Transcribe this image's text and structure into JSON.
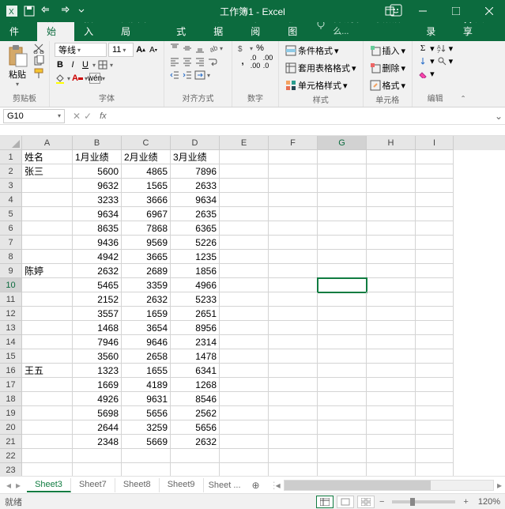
{
  "titlebar": {
    "title": "工作簿1 - Excel"
  },
  "tabs": {
    "file": "文件",
    "home": "开始",
    "insert": "插入",
    "layout": "页面布局",
    "formulas": "公式",
    "data": "数据",
    "review": "审阅",
    "view": "视图",
    "tellme": "告诉我您想要做什么...",
    "login": "登录",
    "share": "共享"
  },
  "ribbon": {
    "clipboard": {
      "label": "剪贴板",
      "paste": "粘贴"
    },
    "font": {
      "label": "字体",
      "name": "等线",
      "size": "11"
    },
    "align": {
      "label": "对齐方式",
      "wrap": ""
    },
    "number": {
      "label": "数字"
    },
    "styles": {
      "label": "样式",
      "cond": "条件格式",
      "table": "套用表格格式",
      "cell": "单元格样式"
    },
    "cells": {
      "label": "单元格",
      "insert": "插入",
      "delete": "删除",
      "format": "格式"
    },
    "editing": {
      "label": "编辑"
    }
  },
  "namebox": "G10",
  "formula": "",
  "columns": [
    "A",
    "B",
    "C",
    "D",
    "E",
    "F",
    "G",
    "H",
    "I"
  ],
  "row_count": 23,
  "selected": {
    "row": 10,
    "col": "G"
  },
  "data_cells": {
    "headers": [
      "姓名",
      "1月业绩",
      "2月业绩",
      "3月业绩"
    ],
    "rows": [
      {
        "a": "张三",
        "b": 5600,
        "c": 4865,
        "d": 7896
      },
      {
        "a": "",
        "b": 9632,
        "c": 1565,
        "d": 2633
      },
      {
        "a": "",
        "b": 3233,
        "c": 3666,
        "d": 9634
      },
      {
        "a": "",
        "b": 9634,
        "c": 6967,
        "d": 2635
      },
      {
        "a": "",
        "b": 8635,
        "c": 7868,
        "d": 6365
      },
      {
        "a": "",
        "b": 9436,
        "c": 9569,
        "d": 5226
      },
      {
        "a": "",
        "b": 4942,
        "c": 3665,
        "d": 1235
      },
      {
        "a": "陈婷",
        "b": 2632,
        "c": 2689,
        "d": 1856
      },
      {
        "a": "",
        "b": 5465,
        "c": 3359,
        "d": 4966
      },
      {
        "a": "",
        "b": 2152,
        "c": 2632,
        "d": 5233
      },
      {
        "a": "",
        "b": 3557,
        "c": 1659,
        "d": 2651
      },
      {
        "a": "",
        "b": 1468,
        "c": 3654,
        "d": 8956
      },
      {
        "a": "",
        "b": 7946,
        "c": 9646,
        "d": 2314
      },
      {
        "a": "",
        "b": 3560,
        "c": 2658,
        "d": 1478
      },
      {
        "a": "王五",
        "b": 1323,
        "c": 1655,
        "d": 6341
      },
      {
        "a": "",
        "b": 1669,
        "c": 4189,
        "d": 1268
      },
      {
        "a": "",
        "b": 4926,
        "c": 9631,
        "d": 8546
      },
      {
        "a": "",
        "b": 5698,
        "c": 5656,
        "d": 2562
      },
      {
        "a": "",
        "b": 2644,
        "c": 3259,
        "d": 5656
      },
      {
        "a": "",
        "b": 2348,
        "c": 5669,
        "d": 2632
      }
    ]
  },
  "sheets": {
    "active": "Sheet3",
    "list": [
      "Sheet3",
      "Sheet7",
      "Sheet8",
      "Sheet9"
    ],
    "more": "Sheet ..."
  },
  "status": {
    "ready": "就绪",
    "zoom": "120%"
  }
}
